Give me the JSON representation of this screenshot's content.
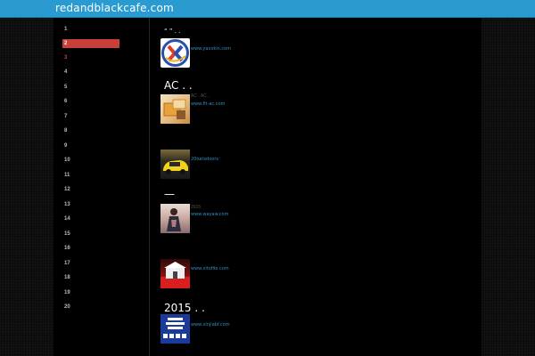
{
  "header": {
    "site_title": "redandblackcafe.com",
    "bar_color": "#2a9bd0"
  },
  "sidebar": {
    "active_color": "#c9403a",
    "items": [
      "1",
      "2",
      "3",
      "4",
      "5",
      "6",
      "7",
      "8",
      "9",
      "10",
      "11",
      "12",
      "13",
      "14",
      "15",
      "16",
      "17",
      "18",
      "19",
      "20"
    ],
    "active_index": 1,
    "highlight_index": 2
  },
  "entries": [
    {
      "title": "“  ”  . .",
      "link": "www.yaxxkin.com",
      "meta": "",
      "icon": "logo-xl-icon"
    },
    {
      "title": "AC       . .",
      "link": "www.fit-ac.com",
      "meta": "AC   .      AC   ,",
      "icon": "food-box-icon"
    },
    {
      "title": "",
      "link": "20oatsdoors",
      "meta": "",
      "icon": "yellow-car-icon"
    },
    {
      "title": "—",
      "link": "www.wayaw.com",
      "meta": "2015",
      "icon": "fashion-model-icon"
    },
    {
      "title": "",
      "link": "www.xitofile.com",
      "meta": "",
      "icon": "red-building-icon"
    },
    {
      "title": "2015         . .",
      "link": "www.xinjiabf.com",
      "meta": "",
      "icon": "blue-menu-icon"
    }
  ]
}
